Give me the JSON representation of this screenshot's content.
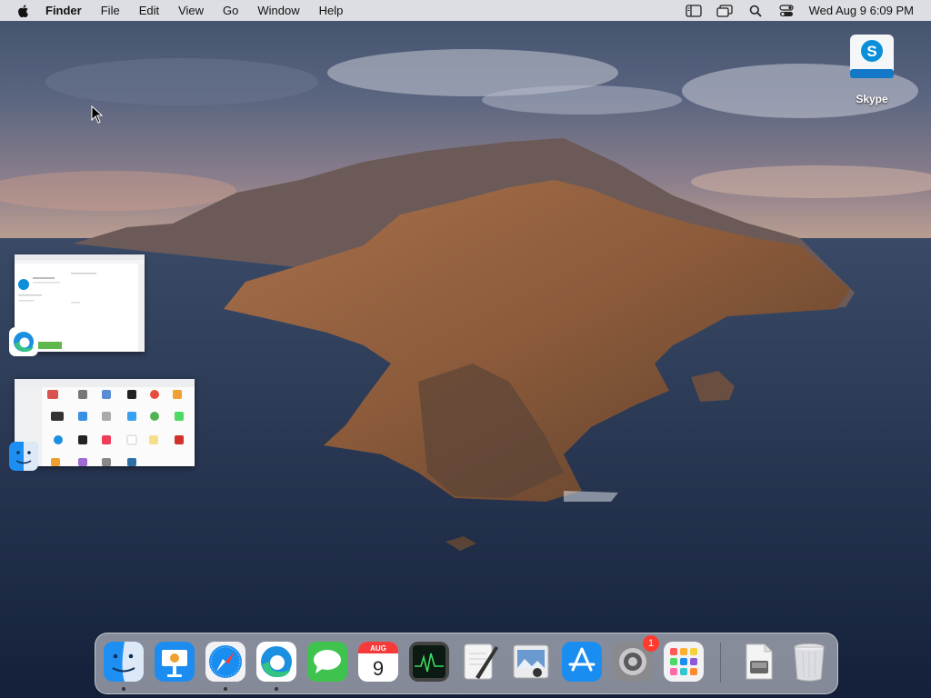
{
  "menubar": {
    "apple_icon": "apple-logo-icon",
    "app_name": "Finder",
    "menus": [
      "File",
      "Edit",
      "View",
      "Go",
      "Window",
      "Help"
    ],
    "status_icons": [
      "sidebar-icon",
      "screen-mirroring-icon",
      "spotlight-search-icon",
      "control-center-icon"
    ],
    "clock": "Wed Aug 9  6:09 PM"
  },
  "desktop": {
    "icons": [
      {
        "label": "Skype",
        "icon": "skype-icon"
      }
    ]
  },
  "window_thumbnails": [
    {
      "app": "Microsoft Edge",
      "icon": "edge-icon",
      "content": "skype-web-page"
    },
    {
      "app": "Finder",
      "icon": "finder-icon",
      "content": "applications-folder-grid"
    }
  ],
  "dock": {
    "apps": [
      {
        "name": "Finder",
        "icon": "finder-icon",
        "running": true
      },
      {
        "name": "Keynote",
        "icon": "keynote-icon",
        "running": false
      },
      {
        "name": "Safari",
        "icon": "safari-icon",
        "running": true
      },
      {
        "name": "Microsoft Edge",
        "icon": "edge-icon",
        "running": true
      },
      {
        "name": "Messages",
        "icon": "messages-icon",
        "running": false
      },
      {
        "name": "Calendar",
        "icon": "calendar-icon",
        "running": false,
        "month": "AUG",
        "day": "9"
      },
      {
        "name": "Activity Monitor",
        "icon": "activity-monitor-icon",
        "running": false
      },
      {
        "name": "Script Editor",
        "icon": "script-editor-icon",
        "running": false
      },
      {
        "name": "Preview",
        "icon": "preview-icon",
        "running": false
      },
      {
        "name": "App Store",
        "icon": "app-store-icon",
        "running": false
      },
      {
        "name": "System Preferences",
        "icon": "system-preferences-icon",
        "running": false,
        "badge": "1"
      },
      {
        "name": "Launchpad",
        "icon": "launchpad-icon",
        "running": false
      }
    ],
    "others": [
      {
        "name": "Disk Image",
        "icon": "disk-image-icon"
      },
      {
        "name": "Trash",
        "icon": "trash-icon"
      }
    ]
  },
  "colors": {
    "menubar_bg": "#e8e8ec",
    "badge_red": "#ff3b30",
    "skype_blue": "#0a8fd8"
  }
}
